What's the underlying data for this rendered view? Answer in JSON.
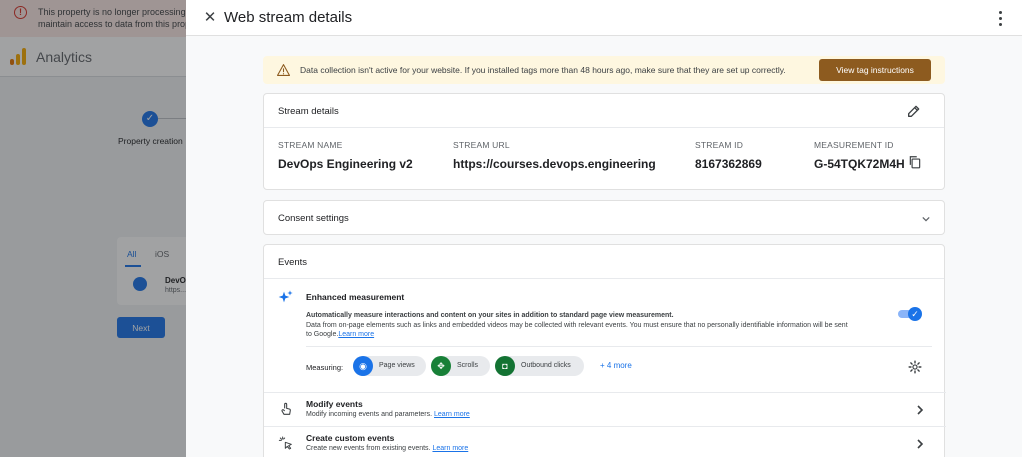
{
  "background": {
    "banner_text_line1": "This property is no longer processing n",
    "banner_text_line2": "maintain access to data from this prop",
    "app_name": "Analytics",
    "step_label": "Property creation",
    "tabs": [
      "All",
      "iOS"
    ],
    "stream_title": "DevO",
    "stream_url": "https...",
    "next_label": "Next"
  },
  "drawer": {
    "title": "Web stream details"
  },
  "alert": {
    "text": "Data collection isn't active for your website. If you installed tags more than 48 hours ago, make sure that they are set up correctly.",
    "button_label": "View tag instructions"
  },
  "stream_details": {
    "title": "Stream details",
    "fields": [
      {
        "label": "STREAM NAME",
        "value": "DevOps Engineering v2"
      },
      {
        "label": "STREAM URL",
        "value": "https://courses.devops.engineering"
      },
      {
        "label": "STREAM ID",
        "value": "8167362869"
      },
      {
        "label": "MEASUREMENT ID",
        "value": "G-54TQK72M4H"
      }
    ]
  },
  "consent": {
    "title": "Consent settings"
  },
  "events": {
    "title": "Events",
    "enhanced": {
      "title": "Enhanced measurement",
      "desc1": "Automatically measure interactions and content on your sites in addition to standard page view measurement.",
      "desc2": "Data from on-page elements such as links and embedded videos may be collected with relevant events. You must ensure that no personally identifiable information will be sent",
      "desc3": "to Google.",
      "link": "Learn more",
      "enabled": true,
      "measuring_label": "Measuring:",
      "chips": [
        {
          "label": "Page views",
          "color": "#1a73e8"
        },
        {
          "label": "Scrolls",
          "color": "#188038"
        },
        {
          "label": "Outbound clicks",
          "color": "#137333"
        }
      ],
      "more_label": "+ 4 more"
    },
    "modify": {
      "title": "Modify events",
      "subtitle": "Modify incoming events and parameters.",
      "link": "Learn more"
    },
    "custom": {
      "title": "Create custom events",
      "subtitle": "Create new events from existing events.",
      "link": "Learn more"
    }
  },
  "colors": {
    "primary": "#1a73e8",
    "alert_bg": "#fef7e0",
    "alert_button": "#8d5b1f",
    "error": "#d93025"
  }
}
